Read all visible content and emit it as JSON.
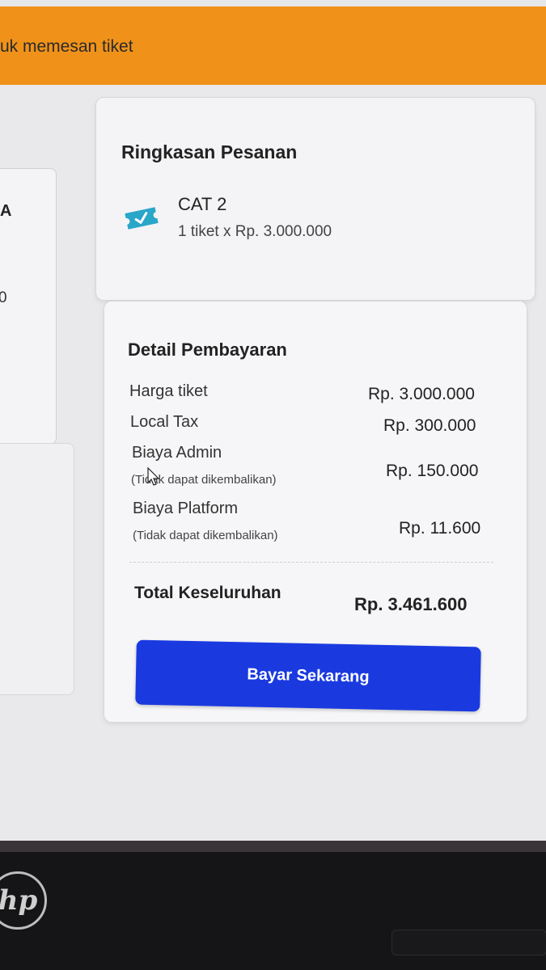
{
  "banner": {
    "text": "uk memesan tiket"
  },
  "left_panel": {
    "partial_letter": "A",
    "partial_digit": "0"
  },
  "summary": {
    "title": "Ringkasan Pesanan",
    "icon": "ticket-check-icon",
    "item_name": "CAT 2",
    "item_detail": "1 tiket x Rp. 3.000.000"
  },
  "payment": {
    "title": "Detail Pembayaran",
    "rows": [
      {
        "label": "Harga tiket",
        "note": "",
        "value": "Rp. 3.000.000"
      },
      {
        "label": "Local Tax",
        "note": "",
        "value": "Rp. 300.000"
      },
      {
        "label": "Biaya Admin",
        "note": "(Tidak dapat dikembalikan)",
        "value": "Rp. 150.000"
      },
      {
        "label": "Biaya Platform",
        "note": "(Tidak dapat dikembalikan)",
        "value": "Rp. 11.600"
      }
    ],
    "total_label": "Total Keseluruhan",
    "total_value": "Rp. 3.461.600",
    "button_label": "Bayar Sekarang"
  },
  "device": {
    "logo": "hp"
  },
  "colors": {
    "banner": "#f0921a",
    "button": "#1a3ae0",
    "ticket_icon": "#2aa6c9"
  }
}
